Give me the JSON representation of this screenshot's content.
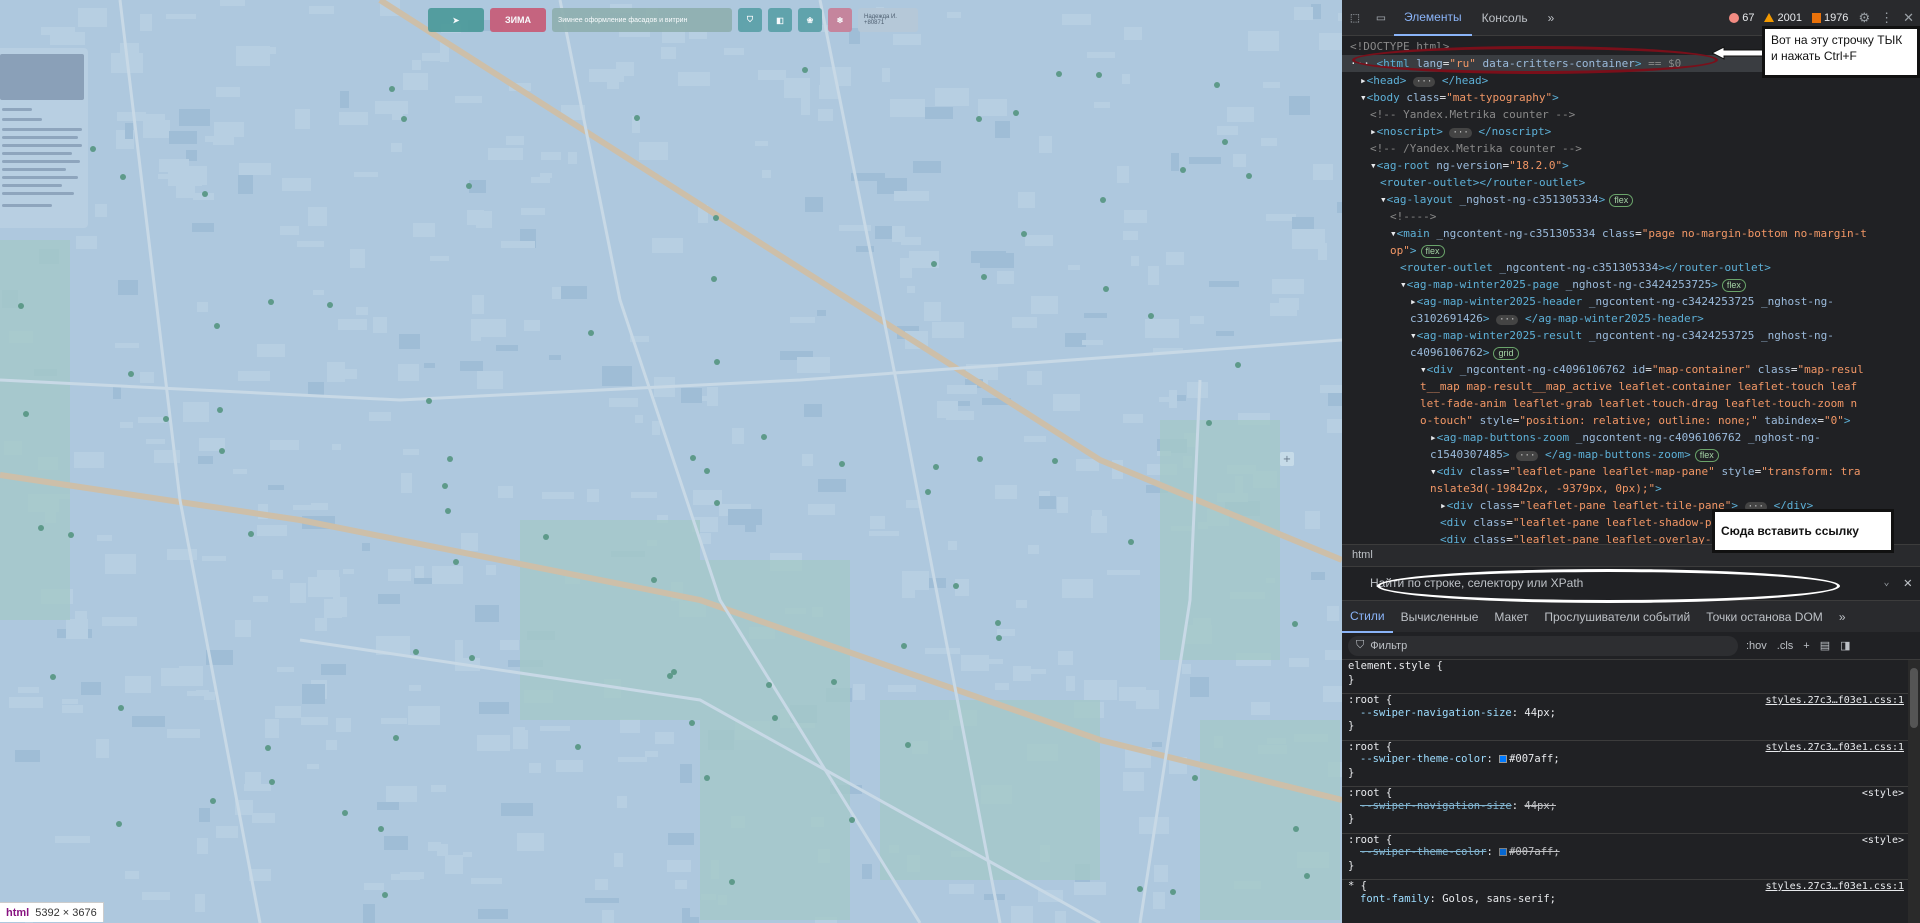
{
  "map": {
    "header": {
      "logo_label": "",
      "zima_label": "ЗИМА",
      "promo_text": "Зимнее оформление фасадов и витрин",
      "user_text": "Надежда И. +80871"
    },
    "zoom_plus": "+",
    "size_badge": {
      "tag": "html",
      "size": "5392 × 3676"
    }
  },
  "devtools": {
    "tabs": [
      "Элементы",
      "Консоль"
    ],
    "more_tabs": "»",
    "errors": "67",
    "warnings": "2001",
    "issues": "1976",
    "dom_lines": [
      {
        "indent": 0,
        "html": "<span class=\"cm\">&lt;!DOCTYPE html&gt;</span>"
      },
      {
        "indent": 0,
        "sel": true,
        "html": "<span class=\"txt\">··· </span><span class=\"tg\">&lt;html</span> <span class=\"an\">lang</span>=<span class=\"av\">\"ru\"</span> <span class=\"an\">data-critters-container</span><span class=\"tg\">&gt;</span> <span class=\"cm\">== $0</span>"
      },
      {
        "indent": 1,
        "html": "▸<span class=\"tg\">&lt;head&gt;</span> <span class=\"ell\">···</span> <span class=\"tg\">&lt;/head&gt;</span>"
      },
      {
        "indent": 1,
        "html": "▾<span class=\"tg\">&lt;body</span> <span class=\"an\">class</span>=<span class=\"av\">\"mat-typography\"</span><span class=\"tg\">&gt;</span>"
      },
      {
        "indent": 2,
        "html": "<span class=\"cm\">&lt;!-- Yandex.Metrika counter --&gt;</span>"
      },
      {
        "indent": 2,
        "html": "▸<span class=\"tg\">&lt;noscript&gt;</span> <span class=\"ell\">···</span> <span class=\"tg\">&lt;/noscript&gt;</span>"
      },
      {
        "indent": 2,
        "html": "<span class=\"cm\">&lt;!-- /Yandex.Metrika counter --&gt;</span>"
      },
      {
        "indent": 2,
        "html": "▾<span class=\"tg\">&lt;ag-root</span> <span class=\"an\">ng-version</span>=<span class=\"av\">\"18.2.0\"</span><span class=\"tg\">&gt;</span>"
      },
      {
        "indent": 3,
        "html": "<span class=\"tg\">&lt;router-outlet&gt;&lt;/router-outlet&gt;</span>"
      },
      {
        "indent": 3,
        "html": "▾<span class=\"tg\">&lt;ag-layout</span> <span class=\"an\">_nghost-ng-c351305334</span><span class=\"tg\">&gt;</span><span class=\"pill\">flex</span>"
      },
      {
        "indent": 4,
        "html": "<span class=\"cm\">&lt;!----&gt;</span>"
      },
      {
        "indent": 4,
        "html": "▾<span class=\"tg\">&lt;main</span> <span class=\"an\">_ngcontent-ng-c351305334</span> <span class=\"an\">class</span>=<span class=\"av\">\"page no-margin-bottom no-margin-t</span>"
      },
      {
        "indent": 4,
        "html": "<span class=\"av\">op\"</span><span class=\"tg\">&gt;</span><span class=\"pill\">flex</span>"
      },
      {
        "indent": 5,
        "html": "<span class=\"tg\">&lt;router-outlet</span> <span class=\"an\">_ngcontent-ng-c351305334</span><span class=\"tg\">&gt;&lt;/router-outlet&gt;</span>"
      },
      {
        "indent": 5,
        "html": "▾<span class=\"tg\">&lt;ag-map-winter2025-page</span> <span class=\"an\">_nghost-ng-c3424253725</span><span class=\"tg\">&gt;</span><span class=\"pill\">flex</span>"
      },
      {
        "indent": 6,
        "html": "▸<span class=\"tg\">&lt;ag-map-winter2025-header</span> <span class=\"an\">_ngcontent-ng-c3424253725 _nghost-ng-</span>"
      },
      {
        "indent": 6,
        "html": "<span class=\"an\">c3102691426</span><span class=\"tg\">&gt;</span> <span class=\"ell\">···</span> <span class=\"tg\">&lt;/ag-map-winter2025-header&gt;</span>"
      },
      {
        "indent": 6,
        "html": "▾<span class=\"tg\">&lt;ag-map-winter2025-result</span> <span class=\"an\">_ngcontent-ng-c3424253725 _nghost-ng-</span>"
      },
      {
        "indent": 6,
        "html": "<span class=\"an\">c4096106762</span><span class=\"tg\">&gt;</span><span class=\"pill\">grid</span>"
      },
      {
        "indent": 7,
        "html": "▾<span class=\"tg\">&lt;div</span> <span class=\"an\">_ngcontent-ng-c4096106762</span> <span class=\"an\">id</span>=<span class=\"av\">\"map-container\"</span> <span class=\"an\">class</span>=<span class=\"av\">\"map-resul</span>"
      },
      {
        "indent": 7,
        "html": "<span class=\"av\">t__map map-result__map_active leaflet-container leaflet-touch leaf</span>"
      },
      {
        "indent": 7,
        "html": "<span class=\"av\">let-fade-anim leaflet-grab leaflet-touch-drag leaflet-touch-zoom n</span>"
      },
      {
        "indent": 7,
        "html": "<span class=\"av\">o-touch\"</span> <span class=\"an\">style</span>=<span class=\"av\">\"position: relative; outline: none;\"</span> <span class=\"an\">tabindex</span>=<span class=\"av\">\"0\"</span><span class=\"tg\">&gt;</span>"
      },
      {
        "indent": 8,
        "html": "▸<span class=\"tg\">&lt;ag-map-buttons-zoom</span> <span class=\"an\">_ngcontent-ng-c4096106762 _nghost-ng-</span>"
      },
      {
        "indent": 8,
        "html": "<span class=\"an\">c1540307485</span><span class=\"tg\">&gt;</span> <span class=\"ell\">···</span> <span class=\"tg\">&lt;/ag-map-buttons-zoom&gt;</span><span class=\"pill\">flex</span>"
      },
      {
        "indent": 8,
        "html": "▾<span class=\"tg\">&lt;div</span> <span class=\"an\">class</span>=<span class=\"av\">\"leaflet-pane leaflet-map-pane\"</span> <span class=\"an\">style</span>=<span class=\"av\">\"transform: tra</span>"
      },
      {
        "indent": 8,
        "html": "<span class=\"av\">nslate3d(-19842px, -9379px, 0px);\"</span><span class=\"tg\">&gt;</span>"
      },
      {
        "indent": 9,
        "html": "▸<span class=\"tg\">&lt;div</span> <span class=\"an\">class</span>=<span class=\"av\">\"leaflet-pane leaflet-tile-pane\"</span><span class=\"tg\">&gt;</span> <span class=\"ell\">···</span> <span class=\"tg\">&lt;/div&gt;</span>"
      },
      {
        "indent": 9,
        "html": "<span class=\"tg\">&lt;div</span> <span class=\"an\">class</span>=<span class=\"av\">\"leaflet-pane leaflet-shadow-pane\"</span><span class=\"tg\">&gt;&lt;/div&gt;</span>"
      },
      {
        "indent": 9,
        "html": "<span class=\"tg\">&lt;div</span> <span class=\"an\">class</span>=<span class=\"av\">\"leaflet-pane leaflet-overlay-pane\"</span><span class=\"tg\">&gt;</span>"
      }
    ],
    "breadcrumb": "html",
    "search_placeholder": "Найти по строке, селектору или XPath",
    "styles_tabs": [
      "Стили",
      "Вычисленные",
      "Макет",
      "Прослушиватели событий",
      "Точки останова DOM"
    ],
    "filter_placeholder": "Фильтр",
    "filter_options": [
      ":hov",
      ".cls",
      "+"
    ],
    "style_rules": [
      {
        "sel": "element.style {",
        "src": "",
        "sep": false
      },
      {
        "sel": "}",
        "src": "",
        "sep": false
      },
      {
        "sel": ":root {",
        "src": "styles.27c3…f03e1.css:1",
        "sep": true
      },
      {
        "prop": "--swiper-navigation-size",
        "val": "44px;",
        "strike": false
      },
      {
        "sel": "}",
        "src": "",
        "sep": false
      },
      {
        "sel": ":root {",
        "src": "styles.27c3…f03e1.css:1",
        "sep": true
      },
      {
        "prop": "--swiper-theme-color",
        "val": "#007aff;",
        "swatch": "#007aff",
        "strike": false
      },
      {
        "sel": "}",
        "src": "",
        "sep": false
      },
      {
        "sel": ":root {",
        "src": "<style>",
        "plain": true,
        "sep": true
      },
      {
        "prop": "--swiper-navigation-size",
        "val": "44px;",
        "strike": true
      },
      {
        "sel": "}",
        "src": "",
        "sep": false
      },
      {
        "sel": ":root {",
        "src": "<style>",
        "plain": true,
        "sep": true
      },
      {
        "prop": "--swiper-theme-color",
        "val": "#007aff;",
        "swatch": "#007aff",
        "strike": true
      },
      {
        "sel": "}",
        "src": "",
        "sep": false
      },
      {
        "sel": "* {",
        "src": "styles.27c3…f03e1.css:1",
        "sep": true
      },
      {
        "prop": "font-family",
        "val": "Golos, sans-serif;",
        "strike": false
      }
    ]
  },
  "annotations": {
    "note_top": "Вот на эту строчку ТЫК и нажать  Ctrl+F",
    "note_link": "Сюда вставить ссылку"
  }
}
